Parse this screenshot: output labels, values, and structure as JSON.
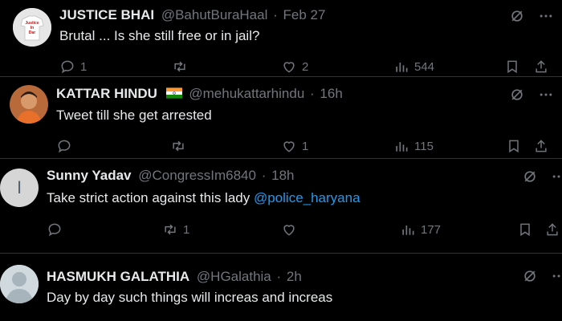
{
  "replies": [
    {
      "name": "JUSTICE BHAI",
      "handle": "@BahutBuraHaal",
      "sep": "·",
      "time": "Feb 27",
      "text": "Brutal ... Is she still free or in jail?",
      "replies": "1",
      "reposts": "",
      "likes": "2",
      "views": "544",
      "avatar_text": "Justice In Dar"
    },
    {
      "name": "KATTAR HINDU",
      "handle": "@mehukattarhindu",
      "sep": "·",
      "time": "16h",
      "text": "Tweet till she get arrested",
      "replies": "",
      "reposts": "",
      "likes": "1",
      "views": "115",
      "flag_colors": [
        "#ff9933",
        "#ffffff",
        "#138808"
      ]
    },
    {
      "name": "Sunny Yadav",
      "handle": "@CongressIm6840",
      "sep": "·",
      "time": "18h",
      "text_before": "Take strict action against this lady ",
      "mention": "@police_haryana",
      "replies": "",
      "reposts": "1",
      "likes": "",
      "views": "177",
      "avatar_initial": "I"
    },
    {
      "name": "HASMUKH GALATHIA",
      "handle": "@HGalathia",
      "sep": "·",
      "time": "2h",
      "text": "Day by day such things will increas and increas"
    }
  ],
  "colors": {
    "background": "#000000",
    "text": "#e7e9ea",
    "muted": "#71767b",
    "link": "#1d9bf0",
    "divider": "#2f3336"
  },
  "icons": [
    "reply-icon",
    "repost-icon",
    "like-icon",
    "views-icon",
    "bookmark-icon",
    "share-icon",
    "grok-icon",
    "more-icon"
  ]
}
